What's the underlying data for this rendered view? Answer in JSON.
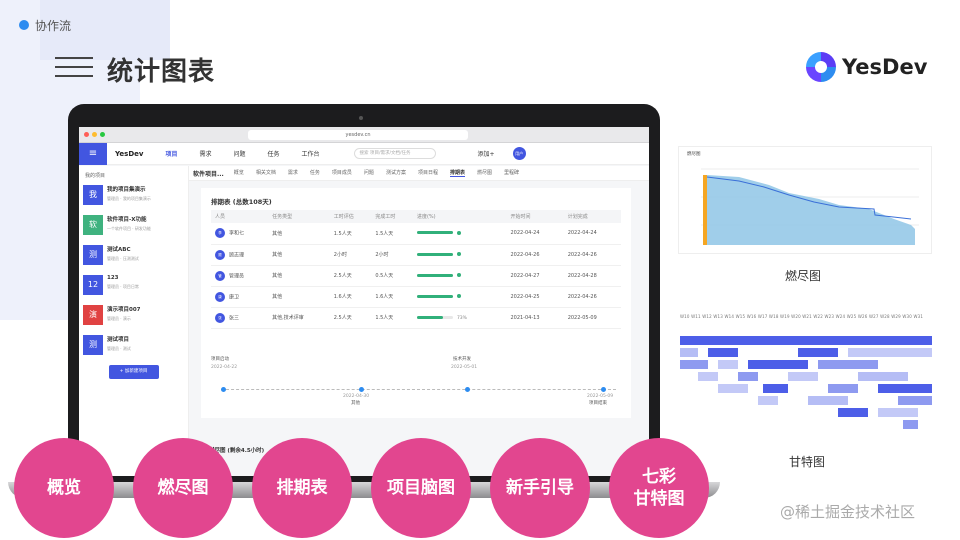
{
  "header": {
    "tag": "协作流",
    "title": "统计图表",
    "logo_text": "YesDev"
  },
  "browser": {
    "url": "yesdev.cn"
  },
  "app": {
    "logo": "YesDev",
    "nav": [
      "项目",
      "需求",
      "问题",
      "任务",
      "工作台"
    ],
    "search_placeholder": "搜索 项目/需求/文档/任务",
    "add_label": "添加+",
    "avatar": "用户"
  },
  "sidebar": {
    "header": "我的项目",
    "projects": [
      {
        "icon": "我",
        "name": "我的项目集演示",
        "desc": "管理员 · 我的项目集演示",
        "color": "#4256e0"
      },
      {
        "icon": "软",
        "name": "软件项目-X功能",
        "desc": "一个软件项目 · 研发功能",
        "color": "#3fb27f"
      },
      {
        "icon": "测",
        "name": "测试ABC",
        "desc": "管理员 · 压测测试",
        "color": "#4256e0"
      },
      {
        "icon": "12",
        "name": "123",
        "desc": "管理员 · 项目日常",
        "color": "#4256e0"
      },
      {
        "icon": "演",
        "name": "演示项目007",
        "desc": "管理员 · 演示",
        "color": "#e04242"
      },
      {
        "icon": "测",
        "name": "测试项目",
        "desc": "管理员 · 测试",
        "color": "#4256e0"
      }
    ],
    "new_project": "+ 加新建项目"
  },
  "content": {
    "project_title": "软件项目...",
    "tabs": [
      "概览",
      "相关文档",
      "需求",
      "任务",
      "项目成员",
      "问题",
      "测试方案",
      "项目日程",
      "排期表",
      "燃尽图",
      "里程碑"
    ],
    "active_tab": "排期表",
    "card_title": "排期表 (总数108天)",
    "columns": [
      "人员",
      "任务类型",
      "工时评估",
      "完成工时",
      "进度(%)",
      "开始时间",
      "计划完成"
    ],
    "rows": [
      {
        "av": "李",
        "name": "李和七",
        "type": "其他",
        "est": "1.5人天",
        "done": "1.5人天",
        "progress": 1.0,
        "start": "2022-04-24",
        "end": "2022-04-24"
      },
      {
        "av": "顾",
        "name": "顾志理",
        "type": "其他",
        "est": "2小时",
        "done": "2小时",
        "progress": 1.0,
        "start": "2022-04-26",
        "end": "2022-04-26"
      },
      {
        "av": "管",
        "name": "管理员",
        "type": "其他",
        "est": "2.5人天",
        "done": "0.5人天",
        "progress": 1.0,
        "start": "2022-04-27",
        "end": "2022-04-28"
      },
      {
        "av": "康",
        "name": "康卫",
        "type": "其他",
        "est": "1.6人天",
        "done": "1.6人天",
        "progress": 1.0,
        "start": "2022-04-25",
        "end": "2022-04-26"
      },
      {
        "av": "张",
        "name": "张三",
        "type": "其他,技术评审",
        "est": "2.5人天",
        "done": "1.5人天",
        "progress": 0.73,
        "progress_text": "73%",
        "start": "2021-04-13",
        "end": "2022-05-09"
      }
    ],
    "milestones": [
      {
        "label": "项目启动",
        "date": "2022-04-22"
      },
      {
        "label": "其他",
        "date": "2022-04-30"
      },
      {
        "label": "技术开发",
        "date": "2022-05-01"
      },
      {
        "label": "项目结束",
        "date": "2022-05-09"
      }
    ],
    "burn_card_title": "燃尽图 (剩余4.5小时)"
  },
  "charts": {
    "burn_title": "燃尽图",
    "burn_caption": "燃尽图",
    "gantt_caption": "甘特图",
    "gantt_header": "W10 W11 W12 W13 W14 W15 W16 W17 W18 W19 W20 W21 W22 W23 W24 W25 W26 W27 W28 W29 W30 W31"
  },
  "features": [
    "概览",
    "燃尽图",
    "排期表",
    "项目脑图",
    "新手引导",
    "七彩\n甘特图"
  ],
  "watermark": "@稀土掘金技术社区",
  "colors": {
    "accent": "#4256e0",
    "feature_pink": "#e2468f",
    "progress_green": "#31b07a"
  }
}
